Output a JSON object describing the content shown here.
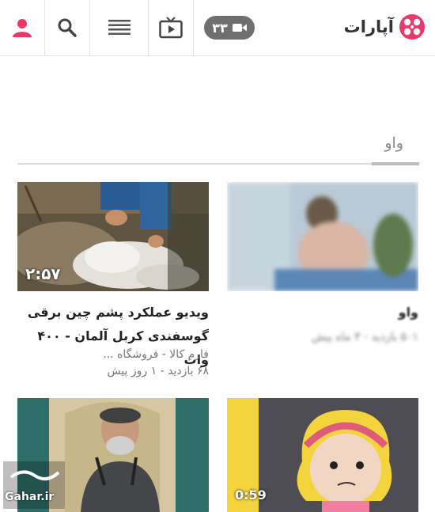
{
  "header": {
    "logo_text": "آپارات",
    "notification_count": "۳۳",
    "icons": [
      "user-icon",
      "search-icon",
      "menu-icon",
      "tv-icon",
      "camera-icon"
    ],
    "accent_color": "#e8396a"
  },
  "section": {
    "title": "واو"
  },
  "videos": [
    {
      "title": "ویدیو عملکرد پشم چین برقی گوسفندی کربل آلمان - ۴۰۰ وات",
      "channel": "فارم کالا - فروشگاه ...",
      "stats": "۶۸ بازدید  -  ۱ روز پیش",
      "duration": "۲:۵۷"
    },
    {
      "title": "واو",
      "channel": "",
      "stats": "۵۰۱ بازدید - ۳ ماه پیش",
      "duration": ""
    },
    {
      "title": "",
      "channel": "",
      "stats": "",
      "duration": ""
    },
    {
      "title": "",
      "channel": "",
      "stats": "",
      "duration": "0:59"
    }
  ],
  "watermark": {
    "text": "Gahar.ir"
  }
}
